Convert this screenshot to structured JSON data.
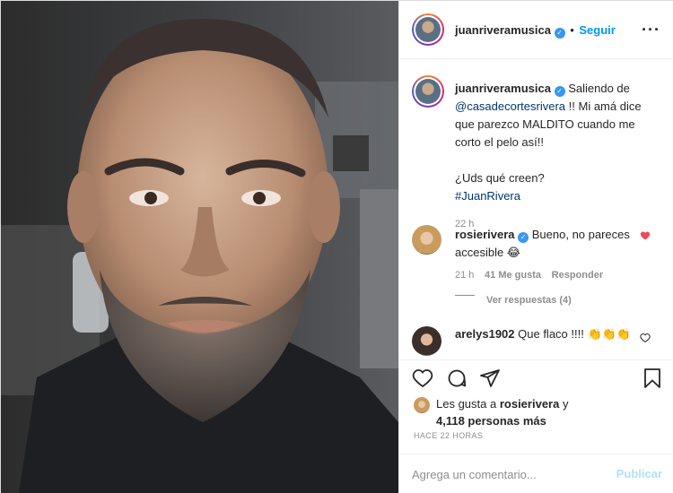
{
  "post": {
    "username": "juanriveramusica",
    "verified_glyph": "✓",
    "follow_separator": "•",
    "follow_label": "Seguir",
    "more_icon": "more-options-icon"
  },
  "caption": {
    "username": "juanriveramusica",
    "text_before": "Saliendo de",
    "mention": "@casadecortesrivera",
    "text_after": "!! Mi amá dice que parezco MALDITO cuando me corto el pelo así!!",
    "question": "¿Uds qué creen?",
    "hashtag": "#JuanRivera",
    "time": "22 h"
  },
  "comments": [
    {
      "username": "rosierivera",
      "verified": true,
      "text": "Bueno, no pareces accesible 😂",
      "time": "21 h",
      "likes": "41 Me gusta",
      "reply_label": "Responder",
      "view_replies": "Ver respuestas (4)",
      "liked": true
    },
    {
      "username": "arelys1902",
      "text": "Que flaco !!!! 👏👏👏",
      "liked": false
    }
  ],
  "likes": {
    "prefix": "Les gusta a",
    "user": "rosierivera",
    "suffix": "y",
    "others": "4,118 personas más"
  },
  "timestamp": "HACE 22 HORAS",
  "comment_form": {
    "placeholder": "Agrega un comentario...",
    "publish_label": "Publicar"
  },
  "colors": {
    "accent": "#0095f6",
    "liked_heart": "#ed4956",
    "publish_disabled": "#b2dffc"
  }
}
